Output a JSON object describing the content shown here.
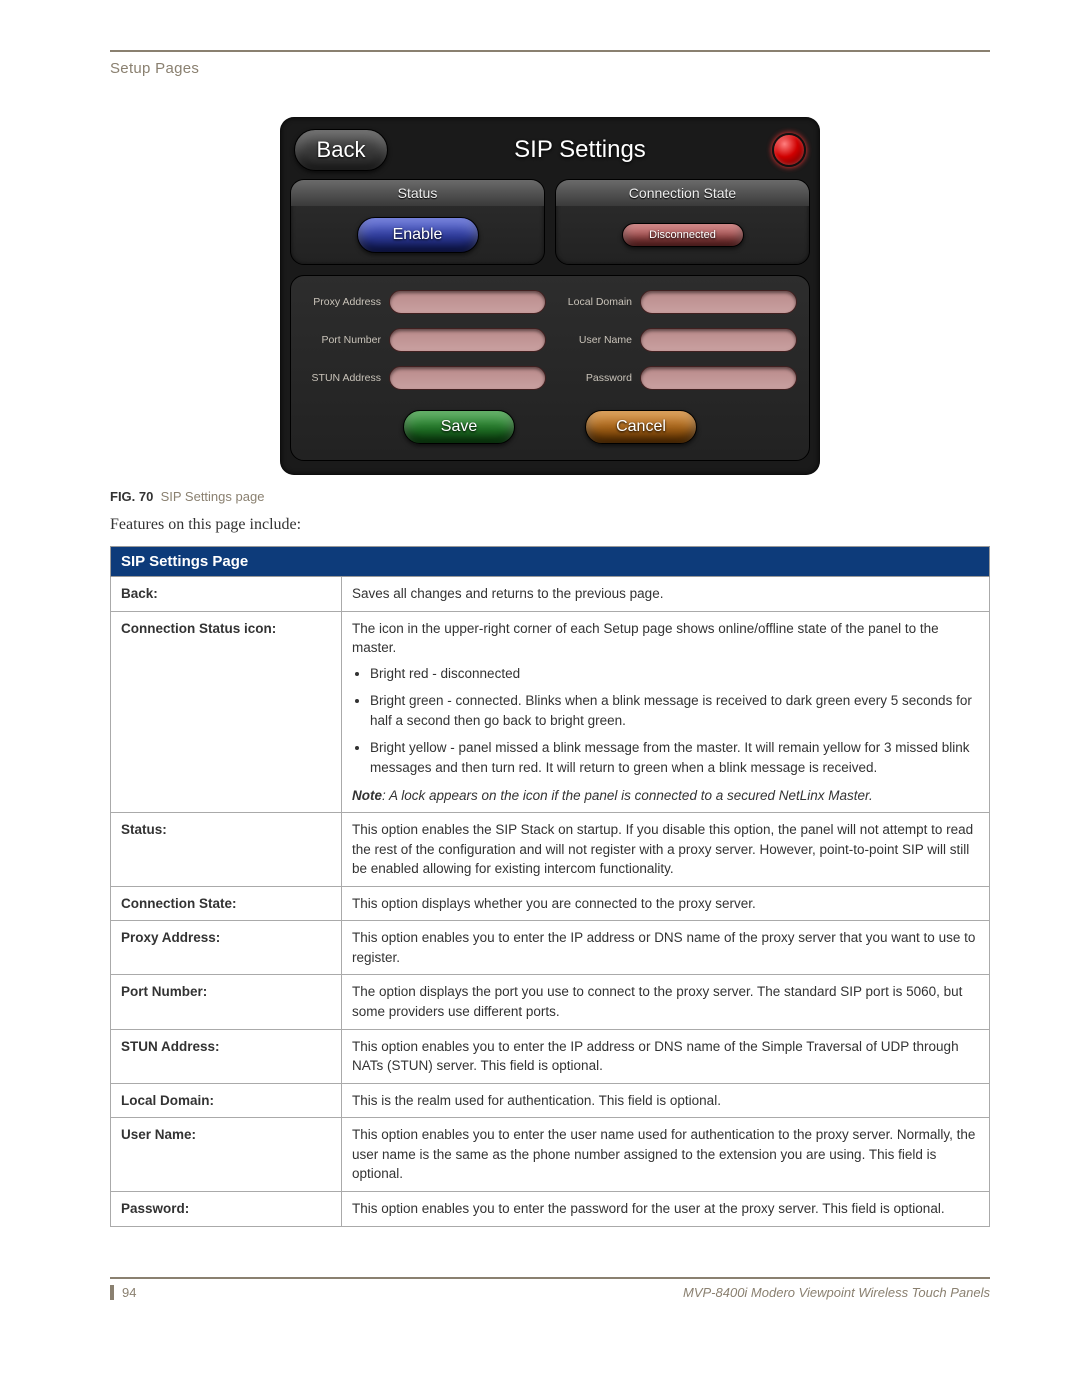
{
  "header": {
    "section": "Setup Pages"
  },
  "screenshot": {
    "back": "Back",
    "title": "SIP Settings",
    "status_panel": {
      "head": "Status",
      "enable": "Enable"
    },
    "conn_panel": {
      "head": "Connection State",
      "status": "Disconnected"
    },
    "fields": {
      "proxy_address": "Proxy Address",
      "port_number": "Port Number",
      "stun_address": "STUN Address",
      "local_domain": "Local Domain",
      "user_name": "User Name",
      "password": "Password"
    },
    "save": "Save",
    "cancel": "Cancel"
  },
  "caption": {
    "fig": "FIG. 70",
    "text": "SIP Settings page"
  },
  "intro": "Features on this page include:",
  "table": {
    "title": "SIP Settings Page",
    "rows": [
      {
        "term": "Back:",
        "desc": "Saves all changes and returns to the previous page."
      },
      {
        "term": "Connection Status icon:",
        "desc_intro": "The icon in the upper-right corner of each Setup page shows online/offline state of the panel to the master.",
        "bullets": [
          "Bright red - disconnected",
          "Bright green - connected. Blinks when a blink message is received to dark green every 5 seconds for half a second then go back to bright green.",
          "Bright yellow - panel missed a blink message from the master. It will remain yellow for 3 missed blink messages and then turn red. It will return to green when a blink message is received."
        ],
        "note": "Note: A lock appears on the icon if the panel is connected to a secured NetLinx Master."
      },
      {
        "term": "Status:",
        "desc": "This option enables the SIP Stack on startup. If you disable this option, the panel will not attempt to read the rest of the configuration and will not register with a proxy server. However, point-to-point SIP will still be enabled allowing for existing intercom functionality."
      },
      {
        "term": "Connection State:",
        "desc": "This option displays whether you are connected to the proxy server."
      },
      {
        "term": "Proxy Address:",
        "desc": "This option enables you to enter the IP address or DNS name of the proxy server that you want to use to register."
      },
      {
        "term": "Port Number:",
        "desc": "The option displays the port you use to connect to the proxy server. The standard SIP port is 5060, but some providers use different ports."
      },
      {
        "term": "STUN Address:",
        "desc": "This option enables you to enter the IP address or DNS name of the Simple Traversal of UDP through NATs (STUN) server. This field is optional."
      },
      {
        "term": "Local Domain:",
        "desc": "This is the realm used for authentication. This field is optional."
      },
      {
        "term": "User Name:",
        "desc": "This option enables you to enter the user name used for authentication to the proxy server. Normally, the user name is the same as the phone number assigned to the extension you are using. This field is optional."
      },
      {
        "term": "Password:",
        "desc": "This option enables you to enter the password for the user at the proxy server. This field is optional."
      }
    ]
  },
  "footer": {
    "page": "94",
    "doc": "MVP-8400i Modero Viewpoint Wireless Touch Panels"
  }
}
